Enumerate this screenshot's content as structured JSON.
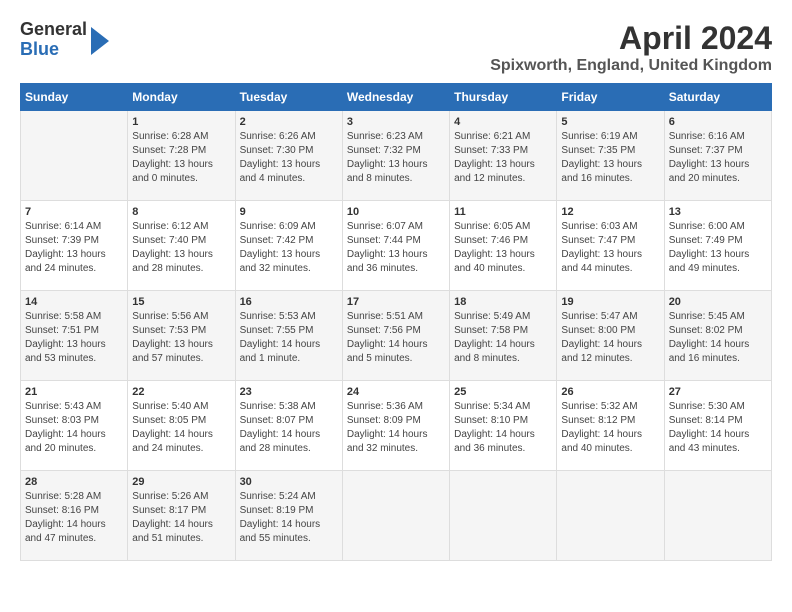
{
  "logo": {
    "general": "General",
    "blue": "Blue",
    "arrow": "►"
  },
  "title": "April 2024",
  "location": "Spixworth, England, United Kingdom",
  "days_of_week": [
    "Sunday",
    "Monday",
    "Tuesday",
    "Wednesday",
    "Thursday",
    "Friday",
    "Saturday"
  ],
  "weeks": [
    [
      {
        "day": "",
        "info": ""
      },
      {
        "day": "1",
        "info": "Sunrise: 6:28 AM\nSunset: 7:28 PM\nDaylight: 13 hours\nand 0 minutes."
      },
      {
        "day": "2",
        "info": "Sunrise: 6:26 AM\nSunset: 7:30 PM\nDaylight: 13 hours\nand 4 minutes."
      },
      {
        "day": "3",
        "info": "Sunrise: 6:23 AM\nSunset: 7:32 PM\nDaylight: 13 hours\nand 8 minutes."
      },
      {
        "day": "4",
        "info": "Sunrise: 6:21 AM\nSunset: 7:33 PM\nDaylight: 13 hours\nand 12 minutes."
      },
      {
        "day": "5",
        "info": "Sunrise: 6:19 AM\nSunset: 7:35 PM\nDaylight: 13 hours\nand 16 minutes."
      },
      {
        "day": "6",
        "info": "Sunrise: 6:16 AM\nSunset: 7:37 PM\nDaylight: 13 hours\nand 20 minutes."
      }
    ],
    [
      {
        "day": "7",
        "info": "Sunrise: 6:14 AM\nSunset: 7:39 PM\nDaylight: 13 hours\nand 24 minutes."
      },
      {
        "day": "8",
        "info": "Sunrise: 6:12 AM\nSunset: 7:40 PM\nDaylight: 13 hours\nand 28 minutes."
      },
      {
        "day": "9",
        "info": "Sunrise: 6:09 AM\nSunset: 7:42 PM\nDaylight: 13 hours\nand 32 minutes."
      },
      {
        "day": "10",
        "info": "Sunrise: 6:07 AM\nSunset: 7:44 PM\nDaylight: 13 hours\nand 36 minutes."
      },
      {
        "day": "11",
        "info": "Sunrise: 6:05 AM\nSunset: 7:46 PM\nDaylight: 13 hours\nand 40 minutes."
      },
      {
        "day": "12",
        "info": "Sunrise: 6:03 AM\nSunset: 7:47 PM\nDaylight: 13 hours\nand 44 minutes."
      },
      {
        "day": "13",
        "info": "Sunrise: 6:00 AM\nSunset: 7:49 PM\nDaylight: 13 hours\nand 49 minutes."
      }
    ],
    [
      {
        "day": "14",
        "info": "Sunrise: 5:58 AM\nSunset: 7:51 PM\nDaylight: 13 hours\nand 53 minutes."
      },
      {
        "day": "15",
        "info": "Sunrise: 5:56 AM\nSunset: 7:53 PM\nDaylight: 13 hours\nand 57 minutes."
      },
      {
        "day": "16",
        "info": "Sunrise: 5:53 AM\nSunset: 7:55 PM\nDaylight: 14 hours\nand 1 minute."
      },
      {
        "day": "17",
        "info": "Sunrise: 5:51 AM\nSunset: 7:56 PM\nDaylight: 14 hours\nand 5 minutes."
      },
      {
        "day": "18",
        "info": "Sunrise: 5:49 AM\nSunset: 7:58 PM\nDaylight: 14 hours\nand 8 minutes."
      },
      {
        "day": "19",
        "info": "Sunrise: 5:47 AM\nSunset: 8:00 PM\nDaylight: 14 hours\nand 12 minutes."
      },
      {
        "day": "20",
        "info": "Sunrise: 5:45 AM\nSunset: 8:02 PM\nDaylight: 14 hours\nand 16 minutes."
      }
    ],
    [
      {
        "day": "21",
        "info": "Sunrise: 5:43 AM\nSunset: 8:03 PM\nDaylight: 14 hours\nand 20 minutes."
      },
      {
        "day": "22",
        "info": "Sunrise: 5:40 AM\nSunset: 8:05 PM\nDaylight: 14 hours\nand 24 minutes."
      },
      {
        "day": "23",
        "info": "Sunrise: 5:38 AM\nSunset: 8:07 PM\nDaylight: 14 hours\nand 28 minutes."
      },
      {
        "day": "24",
        "info": "Sunrise: 5:36 AM\nSunset: 8:09 PM\nDaylight: 14 hours\nand 32 minutes."
      },
      {
        "day": "25",
        "info": "Sunrise: 5:34 AM\nSunset: 8:10 PM\nDaylight: 14 hours\nand 36 minutes."
      },
      {
        "day": "26",
        "info": "Sunrise: 5:32 AM\nSunset: 8:12 PM\nDaylight: 14 hours\nand 40 minutes."
      },
      {
        "day": "27",
        "info": "Sunrise: 5:30 AM\nSunset: 8:14 PM\nDaylight: 14 hours\nand 43 minutes."
      }
    ],
    [
      {
        "day": "28",
        "info": "Sunrise: 5:28 AM\nSunset: 8:16 PM\nDaylight: 14 hours\nand 47 minutes."
      },
      {
        "day": "29",
        "info": "Sunrise: 5:26 AM\nSunset: 8:17 PM\nDaylight: 14 hours\nand 51 minutes."
      },
      {
        "day": "30",
        "info": "Sunrise: 5:24 AM\nSunset: 8:19 PM\nDaylight: 14 hours\nand 55 minutes."
      },
      {
        "day": "",
        "info": ""
      },
      {
        "day": "",
        "info": ""
      },
      {
        "day": "",
        "info": ""
      },
      {
        "day": "",
        "info": ""
      }
    ]
  ]
}
